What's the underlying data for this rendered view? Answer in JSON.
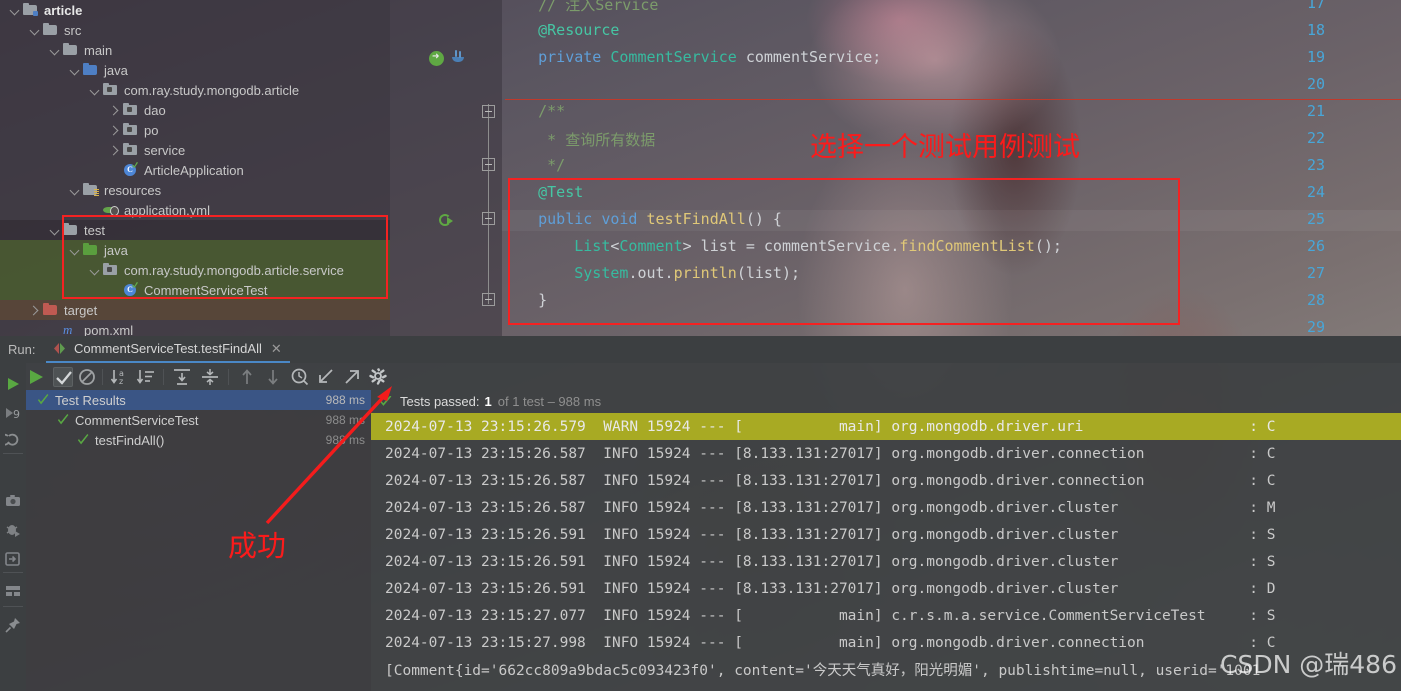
{
  "project_tree": {
    "rows": [
      {
        "indent": 1,
        "arrow": "down",
        "icon": "folder-module",
        "label": "article",
        "bold": true,
        "hl": ""
      },
      {
        "indent": 2,
        "arrow": "down",
        "icon": "folder-src",
        "label": "src",
        "bold": false,
        "hl": ""
      },
      {
        "indent": 3,
        "arrow": "down",
        "icon": "folder-grey",
        "label": "main",
        "bold": false,
        "hl": ""
      },
      {
        "indent": 4,
        "arrow": "down",
        "icon": "folder-blue",
        "label": "java",
        "bold": false,
        "hl": ""
      },
      {
        "indent": 5,
        "arrow": "down",
        "icon": "package",
        "label": "com.ray.study.mongodb.article",
        "bold": false,
        "hl": ""
      },
      {
        "indent": 6,
        "arrow": "right",
        "icon": "package",
        "label": "dao",
        "bold": false,
        "hl": ""
      },
      {
        "indent": 6,
        "arrow": "right",
        "icon": "package",
        "label": "po",
        "bold": false,
        "hl": ""
      },
      {
        "indent": 6,
        "arrow": "right",
        "icon": "package",
        "label": "service",
        "bold": false,
        "hl": ""
      },
      {
        "indent": 6,
        "arrow": "none",
        "icon": "class-run",
        "label": "ArticleApplication",
        "bold": false,
        "hl": ""
      },
      {
        "indent": 4,
        "arrow": "down",
        "icon": "folder-resources",
        "label": "resources",
        "bold": false,
        "hl": ""
      },
      {
        "indent": 5,
        "arrow": "none",
        "icon": "yaml",
        "label": "application.yml",
        "bold": false,
        "hl": ""
      },
      {
        "indent": 3,
        "arrow": "down",
        "icon": "folder-grey",
        "label": "test",
        "bold": false,
        "hl": "dark"
      },
      {
        "indent": 4,
        "arrow": "down",
        "icon": "folder-green",
        "label": "java",
        "bold": false,
        "hl": "green"
      },
      {
        "indent": 5,
        "arrow": "down",
        "icon": "package",
        "label": "com.ray.study.mongodb.article.service",
        "bold": false,
        "hl": "green"
      },
      {
        "indent": 6,
        "arrow": "none",
        "icon": "class-run",
        "label": "CommentServiceTest",
        "bold": false,
        "hl": "green"
      },
      {
        "indent": 2,
        "arrow": "right",
        "icon": "folder-red",
        "label": "target",
        "bold": false,
        "hl": "brown"
      },
      {
        "indent": 3,
        "arrow": "none",
        "icon": "maven",
        "label": "pom.xml",
        "bold": false,
        "hl": ""
      }
    ]
  },
  "editor": {
    "line_numbers": [
      "17",
      "18",
      "19",
      "20",
      "21",
      "22",
      "23",
      "24",
      "25",
      "26",
      "27",
      "28",
      "29"
    ],
    "lines": [
      {
        "num": "17",
        "html": "<span class='cmt'>    // 注入Service</span>"
      },
      {
        "num": "18",
        "html": "<span class='anno'>    @Resource</span>"
      },
      {
        "num": "19",
        "html": "<span class='k'>    private</span> <span class='typ'>CommentService</span> <span class='pl'>commentService;</span>"
      },
      {
        "num": "20",
        "html": ""
      },
      {
        "num": "21",
        "html": "<span class='cmt'>    /**</span>"
      },
      {
        "num": "22",
        "html": "<span class='cmt'>     * 查询所有数据</span>"
      },
      {
        "num": "23",
        "html": "<span class='cmt'>     */</span>"
      },
      {
        "num": "24",
        "html": "<span class='anno'>    @Test</span>"
      },
      {
        "num": "25",
        "html": "<span class='k'>    public void</span> <span class='mth'>testFindAll</span><span class='pl'>() {</span>"
      },
      {
        "num": "26",
        "html": "<span class='pl'>        </span><span class='typ'>List</span><span class='pl'>&lt;</span><span class='typ'>Comment</span><span class='pl'>&gt; list = commentService.</span><span class='mth'>findCommentList</span><span class='pl'>();</span>"
      },
      {
        "num": "27",
        "html": "<span class='pl'>        </span><span class='typ'>System</span><span class='pl'>.out.</span><span class='mth'>println</span><span class='pl'>(list);</span>"
      },
      {
        "num": "28",
        "html": "<span class='pl'>    }</span>"
      },
      {
        "num": "29",
        "html": ""
      }
    ],
    "gutter_icons": [
      {
        "name": "spring-bean-icon",
        "line": "19"
      },
      {
        "name": "java-class-icon",
        "line": "19"
      },
      {
        "name": "run-test-icon",
        "line": "25"
      }
    ]
  },
  "annotations": {
    "select_test_case": "选择一个测试用例测试",
    "success": "成功"
  },
  "run_window": {
    "run_label": "Run:",
    "tab_name": "CommentServiceTest.testFindAll",
    "tab_close": "✕",
    "left_strip_icons": [
      "rerun-icon",
      "rerun-9-icon",
      "restart-icon",
      "stop-icon",
      "screenshot-icon",
      "debug-icon",
      "export-icon",
      "layout-icon",
      "pin-icon"
    ],
    "toolbar_icons": [
      "show-passed-icon",
      "hide-ignored-icon",
      "sort-alphabetically-icon",
      "sort-by-duration-icon",
      "expand-all-icon",
      "collapse-all-icon",
      "previous-icon",
      "next-icon",
      "history-icon",
      "import-results-icon",
      "export-results-icon",
      "settings-icon"
    ],
    "test_tree": [
      {
        "indent": 0,
        "arrow": "down",
        "label": "Test Results",
        "time": "988 ms",
        "selected": true,
        "dim": false
      },
      {
        "indent": 1,
        "arrow": "down",
        "label": "CommentServiceTest",
        "time": "988 ms",
        "selected": false,
        "dim": true
      },
      {
        "indent": 2,
        "arrow": "none",
        "label": "testFindAll()",
        "time": "988 ms",
        "selected": false,
        "dim": true
      }
    ],
    "console_header": {
      "passed_label": "Tests passed:",
      "passed_count": "1",
      "of_text": "of 1 test – 988 ms"
    },
    "log_lines": [
      {
        "text": "2024-07-13 23:15:26.579  WARN 15924 --- [           main] org.mongodb.driver.uri                   : C",
        "warn": true
      },
      {
        "text": "2024-07-13 23:15:26.587  INFO 15924 --- [8.133.131:27017] org.mongodb.driver.connection            : C",
        "warn": false
      },
      {
        "text": "2024-07-13 23:15:26.587  INFO 15924 --- [8.133.131:27017] org.mongodb.driver.connection            : C",
        "warn": false
      },
      {
        "text": "2024-07-13 23:15:26.587  INFO 15924 --- [8.133.131:27017] org.mongodb.driver.cluster               : M",
        "warn": false
      },
      {
        "text": "2024-07-13 23:15:26.591  INFO 15924 --- [8.133.131:27017] org.mongodb.driver.cluster               : S",
        "warn": false
      },
      {
        "text": "2024-07-13 23:15:26.591  INFO 15924 --- [8.133.131:27017] org.mongodb.driver.cluster               : S",
        "warn": false
      },
      {
        "text": "2024-07-13 23:15:26.591  INFO 15924 --- [8.133.131:27017] org.mongodb.driver.cluster               : D",
        "warn": false
      },
      {
        "text": "2024-07-13 23:15:27.077  INFO 15924 --- [           main] c.r.s.m.a.service.CommentServiceTest     : S",
        "warn": false
      },
      {
        "text": "2024-07-13 23:15:27.998  INFO 15924 --- [           main] org.mongodb.driver.connection            : C",
        "warn": false
      },
      {
        "text": "[Comment{id='662cc809a9bdac5c093423f0', content='今天天气真好，阳光明媚', publishtime=null, userid='1001",
        "warn": false
      }
    ]
  },
  "watermark": "CSDN @瑞486",
  "colors": {
    "accent_red": "#f42222",
    "warn_bg": "#a8aa23",
    "selection_blue": "#3a5585",
    "pass_green": "#59a842",
    "linenum_blue": "#48a6d8"
  }
}
